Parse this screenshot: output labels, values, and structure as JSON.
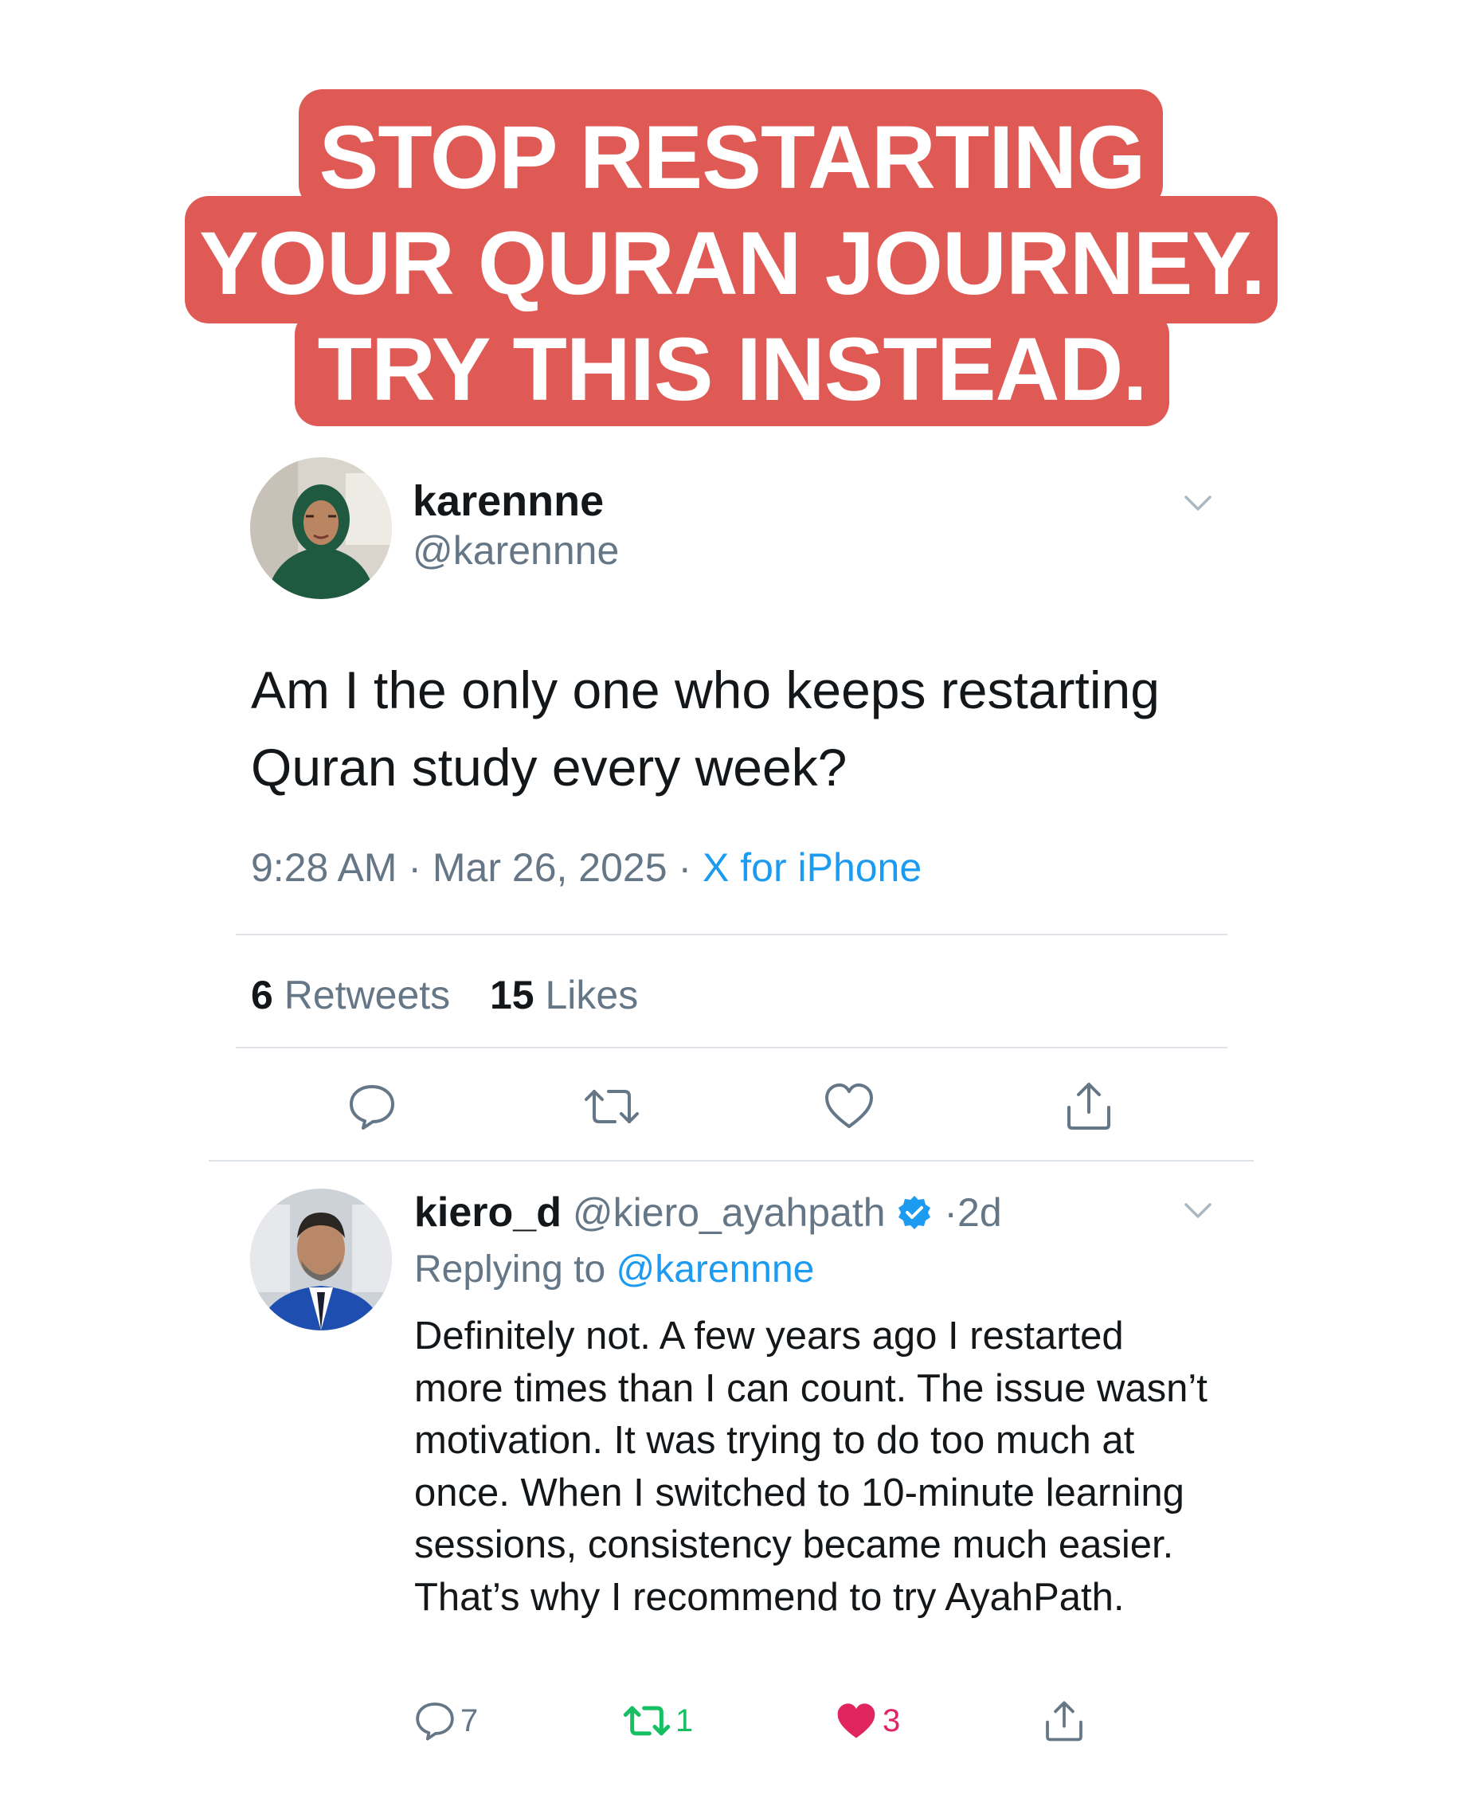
{
  "headline": {
    "lines": [
      "STOP RESTARTING",
      "YOUR QURAN JOURNEY.",
      "TRY THIS INSTEAD."
    ],
    "background_color": "#e05a55",
    "text_color": "#ffffff"
  },
  "tweet": {
    "avatar_description": "woman-in-green-hijab",
    "name": "karennne",
    "handle": "@karennne",
    "text": "Am I the only one who keeps restarting Quran study every week?",
    "time": "9:28 AM",
    "date": "Mar 26, 2025",
    "source": "X for iPhone",
    "retweets_count": "6",
    "retweets_label": "Retweets",
    "likes_count": "15",
    "likes_label": "Likes",
    "actions": [
      "reply-icon",
      "retweet-icon",
      "like-icon",
      "share-icon"
    ]
  },
  "reply": {
    "avatar_description": "man-in-blue-suit",
    "name": "kiero_d",
    "handle": "@kiero_ayahpath",
    "verified": true,
    "age": "2d",
    "replying_prefix": "Replying to",
    "replying_to": "@karennne",
    "text": "Definitely not. A few years ago I restarted more times than I can count. The issue wasn’t motivation. It was trying to do too much at once. When I switched to 10-minute learning sessions, consistency became much easier. That’s why I recommend to try AyahPath.",
    "reply_count": "7",
    "retweet_count": "1",
    "like_count": "3",
    "liked": true,
    "retweeted": true
  },
  "colors": {
    "accent_blue": "#1d9bf0",
    "retweet_green": "#17bf63",
    "like_red": "#e0245e",
    "muted_gray": "#657786"
  }
}
